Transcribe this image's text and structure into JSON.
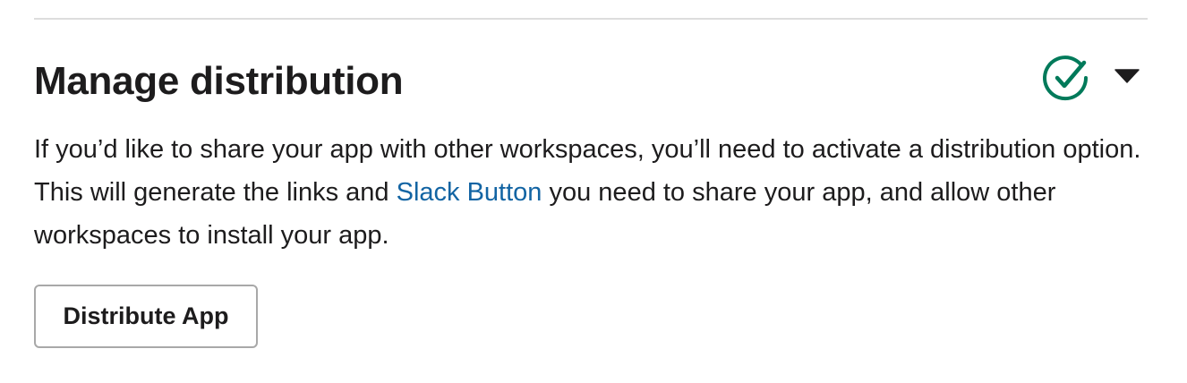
{
  "section": {
    "title": "Manage distribution",
    "status_icon": "check-circle-icon",
    "status_color": "#007a5a",
    "toggle_icon": "caret-down-icon"
  },
  "description": {
    "text_before_link": "If you’d like to share your app with other workspaces, you’ll need to activate a distribution option. This will generate the links and ",
    "link_text": "Slack Button",
    "text_after_link": " you need to share your app, and allow other workspaces to install your app.",
    "link_color": "#1264a3"
  },
  "actions": {
    "distribute_label": "Distribute App"
  }
}
